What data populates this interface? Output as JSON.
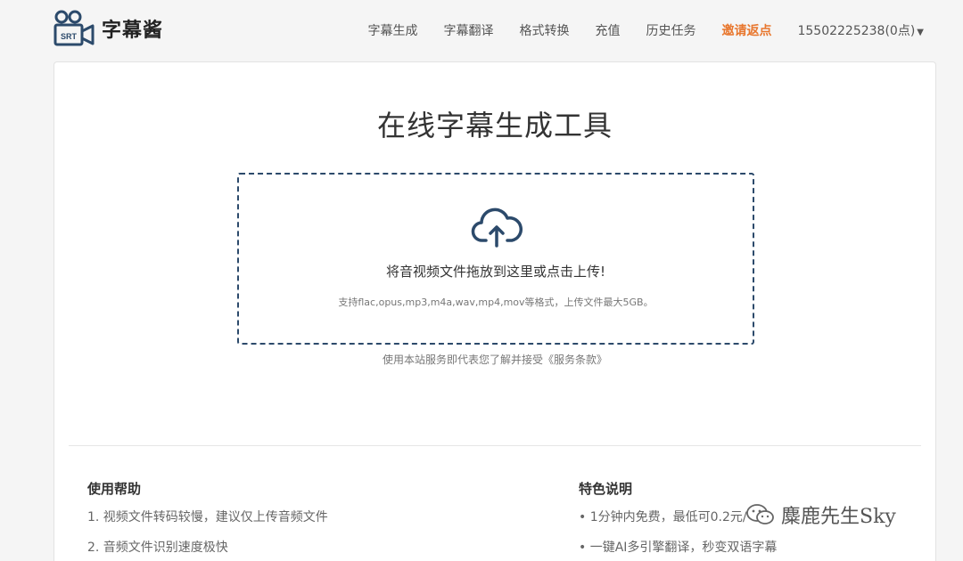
{
  "header": {
    "logo_text": "字幕酱",
    "logo_badge": "SRT",
    "nav": [
      {
        "label": "字幕生成"
      },
      {
        "label": "字幕翻译"
      },
      {
        "label": "格式转换"
      },
      {
        "label": "充值"
      },
      {
        "label": "历史任务"
      },
      {
        "label": "邀请返点"
      }
    ],
    "account": "15502225238(0点)"
  },
  "main": {
    "title": "在线字幕生成工具",
    "upload": {
      "icon": "cloud-upload-icon",
      "text": "将音视频文件拖放到这里或点击上传!",
      "formats": "支持flac,opus,mp3,m4a,wav,mp4,mov等格式，上传文件最大5GB。"
    },
    "terms_prefix": "使用本站服务即代表您了解并接受",
    "terms_link": "《服务条款》"
  },
  "help": {
    "title": "使用帮助",
    "items": [
      "1. 视频文件转码较慢，建议仅上传音频文件",
      "2. 音频文件识别速度极快"
    ]
  },
  "features": {
    "title": "特色说明",
    "items": [
      "• 1分钟内免费，最低可0.2元/",
      "• 一键AI多引擎翻译，秒变双语字幕"
    ]
  },
  "watermark": "麋鹿先生Sky",
  "colors": {
    "accent": "#e8772e",
    "border": "#2c4a6b"
  }
}
